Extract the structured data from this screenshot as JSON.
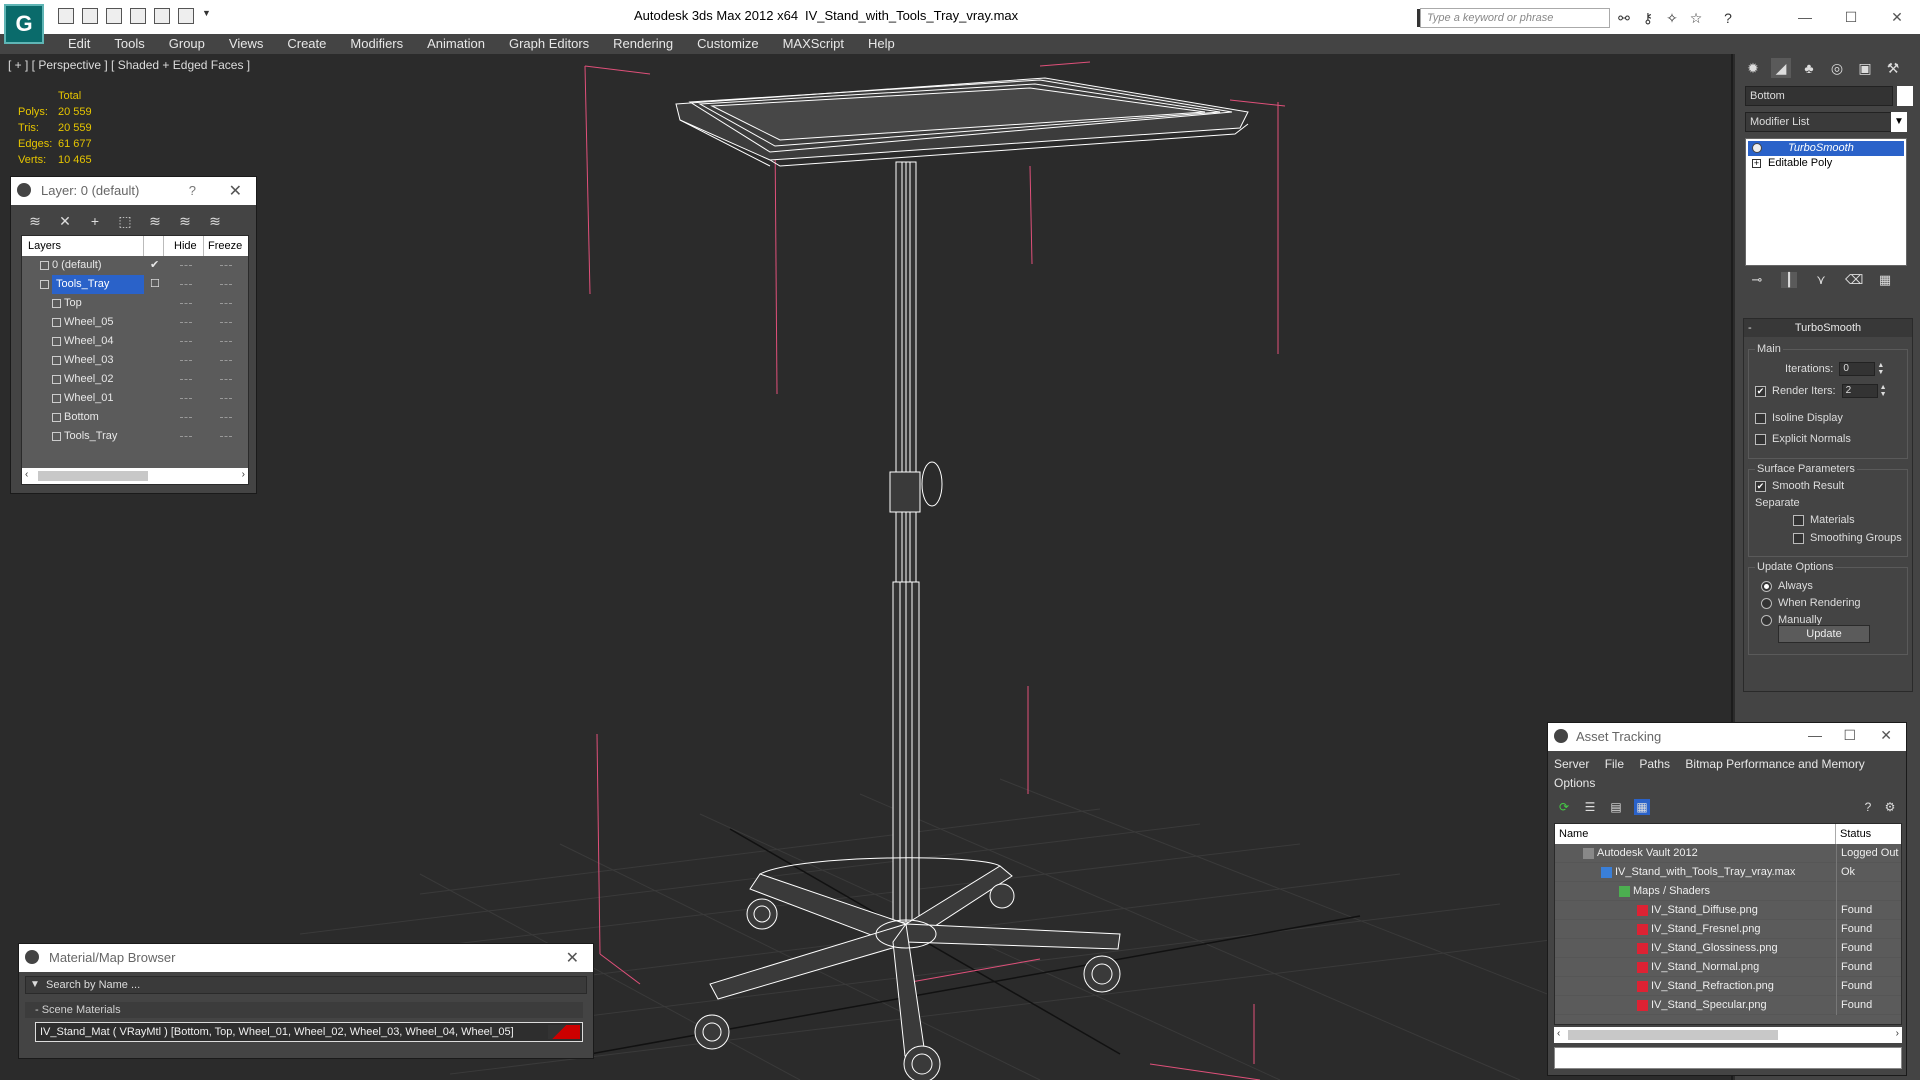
{
  "titlebar": {
    "app_title": "Autodesk 3ds Max  2012 x64",
    "file_title": "IV_Stand_with_Tools_Tray_vray.max",
    "search_placeholder": "Type a keyword or phrase",
    "logo_text": "G"
  },
  "menu": [
    "Edit",
    "Tools",
    "Group",
    "Views",
    "Create",
    "Modifiers",
    "Animation",
    "Graph Editors",
    "Rendering",
    "Customize",
    "MAXScript",
    "Help"
  ],
  "viewport": {
    "label": "[ + ] [ Perspective ] [ Shaded + Edged Faces ]",
    "stats": {
      "header": "Total",
      "polys_label": "Polys:",
      "polys": "20 559",
      "tris_label": "Tris:",
      "tris": "20 559",
      "edges_label": "Edges:",
      "edges": "61 677",
      "verts_label": "Verts:",
      "verts": "10 465"
    }
  },
  "layer_dialog": {
    "title": "Layer: 0 (default)",
    "help": "?",
    "close": "✕",
    "columns": {
      "layers": "Layers",
      "hide": "Hide",
      "freeze": "Freeze"
    },
    "rows": [
      {
        "name": "0 (default)",
        "level": 0,
        "checked": true,
        "selected": false
      },
      {
        "name": "Tools_Tray",
        "level": 0,
        "checked": false,
        "selected": true
      },
      {
        "name": "Top",
        "level": 1
      },
      {
        "name": "Wheel_05",
        "level": 1
      },
      {
        "name": "Wheel_04",
        "level": 1
      },
      {
        "name": "Wheel_03",
        "level": 1
      },
      {
        "name": "Wheel_02",
        "level": 1
      },
      {
        "name": "Wheel_01",
        "level": 1
      },
      {
        "name": "Bottom",
        "level": 1
      },
      {
        "name": "Tools_Tray",
        "level": 1
      }
    ]
  },
  "material_browser": {
    "title": "Material/Map Browser",
    "search_placeholder": "Search by Name ...",
    "section": "- Scene Materials",
    "item": "IV_Stand_Mat  ( VRayMtl )  [Bottom, Top, Wheel_01, Wheel_02, Wheel_03, Wheel_04, Wheel_05]"
  },
  "command_panel": {
    "object_name": "Bottom",
    "modifier_list": "Modifier List",
    "stack": [
      {
        "name": "TurboSmooth",
        "active": true
      },
      {
        "name": "Editable Poly",
        "active": false
      }
    ],
    "turbosmooth": {
      "title": "TurboSmooth",
      "main_label": "Main",
      "iterations_label": "Iterations:",
      "iterations": "0",
      "render_iters_label": "Render Iters:",
      "render_iters": "2",
      "render_iters_checked": true,
      "isoline_label": "Isoline Display",
      "explicit_label": "Explicit Normals",
      "surface_label": "Surface Parameters",
      "smooth_result_label": "Smooth Result",
      "separate_label": "Separate",
      "materials_label": "Materials",
      "smoothing_groups_label": "Smoothing Groups",
      "update_options_label": "Update Options",
      "always_label": "Always",
      "when_rendering_label": "When Rendering",
      "manually_label": "Manually",
      "update_button": "Update"
    }
  },
  "asset_tracking": {
    "title": "Asset Tracking",
    "menu": [
      "Server",
      "File",
      "Paths",
      "Bitmap Performance and Memory",
      "Options"
    ],
    "columns": {
      "name": "Name",
      "status": "Status"
    },
    "rows": [
      {
        "name": "Autodesk Vault 2012",
        "status": "Logged Out",
        "level": 1,
        "icon": "vault"
      },
      {
        "name": "IV_Stand_with_Tools_Tray_vray.max",
        "status": "Ok",
        "level": 2,
        "icon": "max"
      },
      {
        "name": "Maps / Shaders",
        "status": "",
        "level": 3,
        "icon": "folder"
      },
      {
        "name": "IV_Stand_Diffuse.png",
        "status": "Found",
        "level": 4,
        "icon": "png"
      },
      {
        "name": "IV_Stand_Fresnel.png",
        "status": "Found",
        "level": 4,
        "icon": "png"
      },
      {
        "name": "IV_Stand_Glossiness.png",
        "status": "Found",
        "level": 4,
        "icon": "png"
      },
      {
        "name": "IV_Stand_Normal.png",
        "status": "Found",
        "level": 4,
        "icon": "png"
      },
      {
        "name": "IV_Stand_Refraction.png",
        "status": "Found",
        "level": 4,
        "icon": "png"
      },
      {
        "name": "IV_Stand_Specular.png",
        "status": "Found",
        "level": 4,
        "icon": "png"
      }
    ]
  },
  "colors": {
    "selection": "#2a62c9",
    "stats_text": "#e6c500",
    "bbox_lines": "#e0507a",
    "wireframe": "#ffffff"
  }
}
